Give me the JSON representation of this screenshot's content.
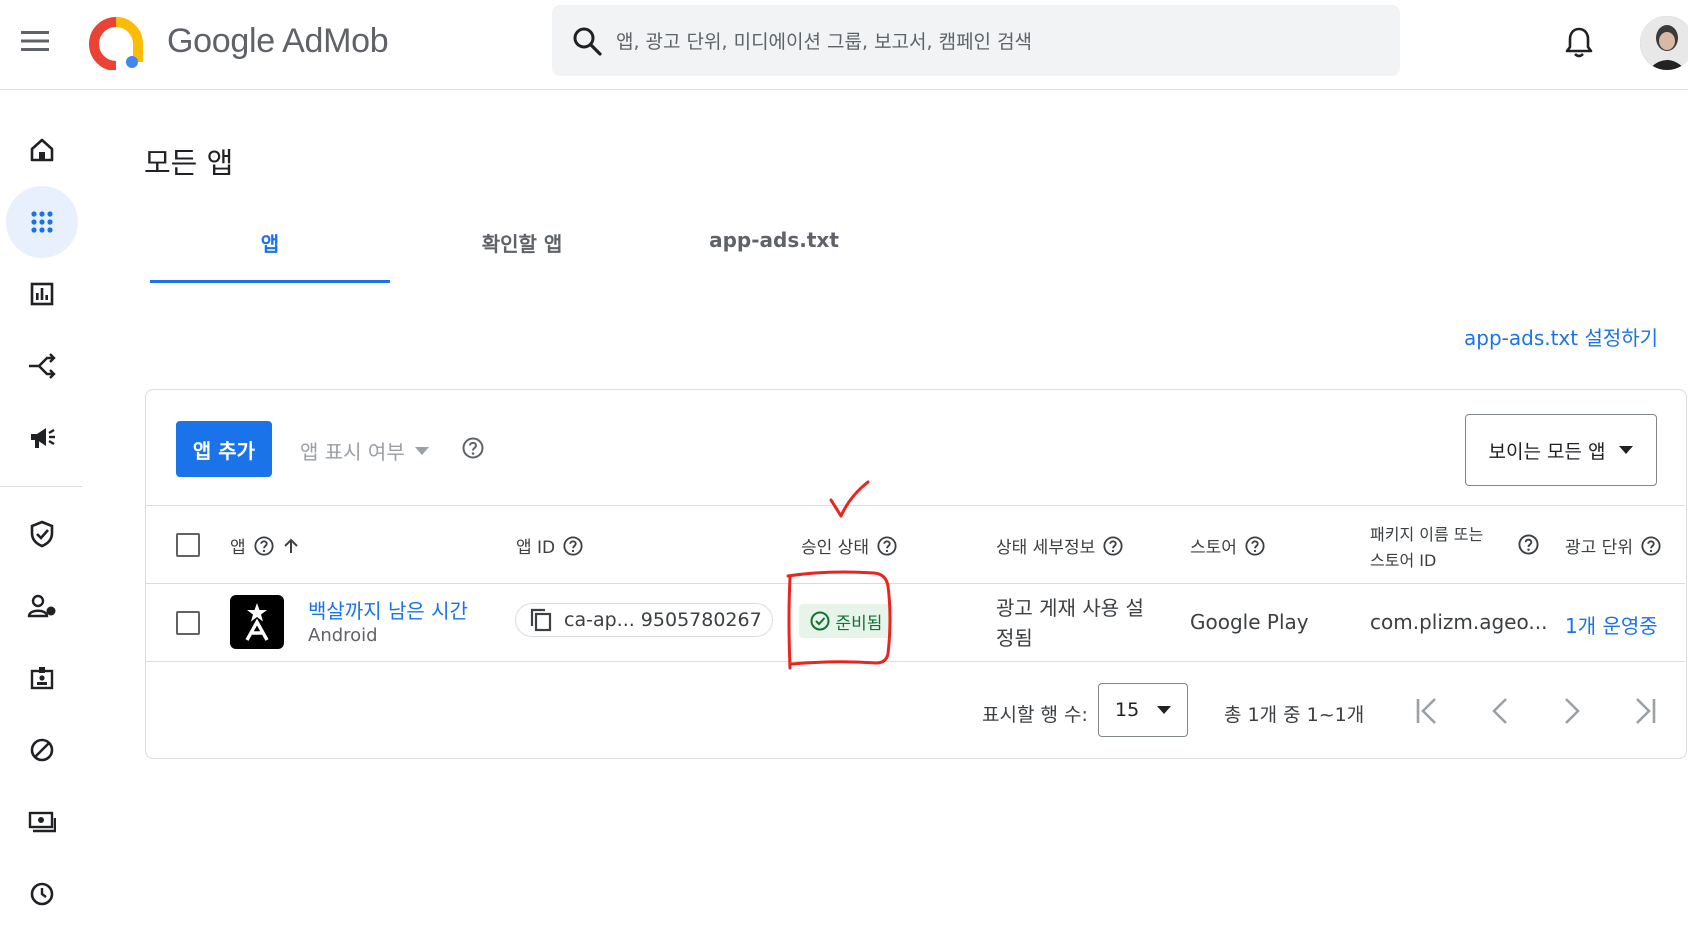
{
  "header": {
    "brand": "Google AdMob",
    "search_placeholder": "앱, 광고 단위, 미디에이션 그룹, 보고서, 캠페인 검색"
  },
  "page": {
    "title": "모든 앱",
    "tabs": [
      {
        "label": "앱",
        "active": true
      },
      {
        "label": "확인할 앱",
        "active": false
      },
      {
        "label": "app-ads.txt",
        "active": false
      }
    ],
    "setup_link": "app-ads.txt 설정하기"
  },
  "toolbar": {
    "add_app": "앱 추가",
    "visibility_filter": "앱 표시 여부",
    "visibility_select": "보이는 모든 앱"
  },
  "table": {
    "columns": [
      "앱",
      "앱 ID",
      "승인 상태",
      "상태 세부정보",
      "스토어",
      "패키지 이름 또는",
      "스토어 ID",
      "광고 단위"
    ],
    "rows": [
      {
        "app_name": "백살까지 남은 시간",
        "platform": "Android",
        "app_id": "ca-ap... 9505780267",
        "status": "준비됨",
        "status_detail_line1": "광고 게재 사용 설",
        "status_detail_line2": "정됨",
        "store": "Google Play",
        "package": "com.plizm.ageo...",
        "ad_units": "1개 운영중"
      }
    ]
  },
  "pagination": {
    "rows_label": "표시할 행 수:",
    "rows_value": "15",
    "range": "총 1개 중 1~1개"
  },
  "colors": {
    "accent": "#1a73e8",
    "status_bg": "#e6f4ea",
    "status_text": "#137333",
    "annotation": "#e8251f"
  }
}
